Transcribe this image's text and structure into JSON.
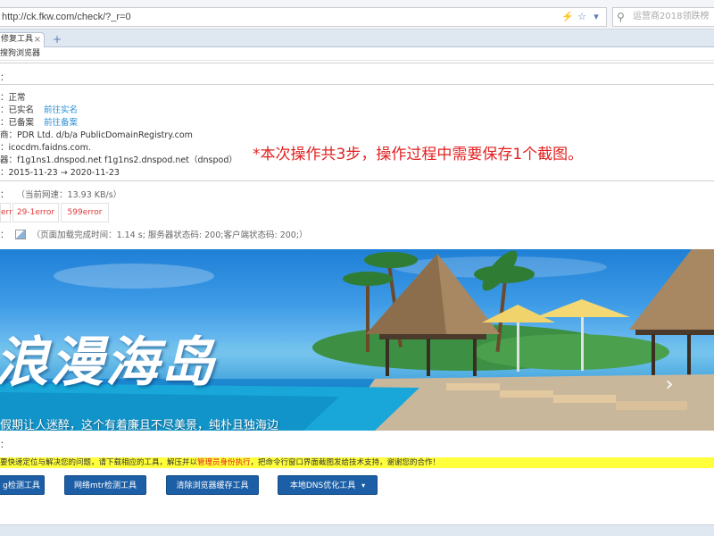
{
  "browser": {
    "url": "http://ck.fkw.com/check/?_r=0",
    "search_placeholder": "运营商2018领跌榜",
    "tab_label": "修复工具",
    "tab_close": "×",
    "new_tab": "+",
    "favorites_item": "搜狗浏览器"
  },
  "info": {
    "blank_line_1": "：",
    "status": "：正常",
    "realname_label": "：已实名",
    "realname_link": "前往实名",
    "beian_label": "：已备案",
    "beian_link": "前往备案",
    "registrar": "商：PDR Ltd. d/b/a PublicDomainRegistry.com",
    "cname": "：icocdm.faidns.com.",
    "dns": "器：f1g1ns1.dnspod.net  f1g1ns2.dnspod.net（dnspod）",
    "period": "：2015-11-23 → 2020-11-23"
  },
  "annotation": "*本次操作共3步，操作过程中需要保存1个截图。",
  "speed": {
    "prefix": "：",
    "text": "（当前网速：13.93 KB/s）"
  },
  "errors": [
    "error",
    "29-1error",
    "599error"
  ],
  "load": {
    "prefix": "：",
    "text": "（页面加载完成时间：1.14 s; 服务器状态码: 200;客户端状态码: 200;）"
  },
  "banner": {
    "title": "浪漫海岛",
    "subtitle": "假期让人迷醉，这个有着廉且不尽美景，纯朴且独海边"
  },
  "section_prefix": "：",
  "notice": {
    "before": "要快速定位与解决您的问题，请下载相应的工具，解压并以",
    "highlight": "管理员身份执行",
    "after": "，把命令行窗口界面截图发给技术支持，谢谢您的合作！"
  },
  "tools": [
    "g检测工具",
    "网络mtr检测工具",
    "清除浏览器缓存工具",
    "本地DNS优化工具"
  ],
  "colors": {
    "accent_blue": "#1c5fa6",
    "notice_yellow": "#ffff3c",
    "annotation_red": "#e22020",
    "link_blue": "#2a8fd8"
  }
}
